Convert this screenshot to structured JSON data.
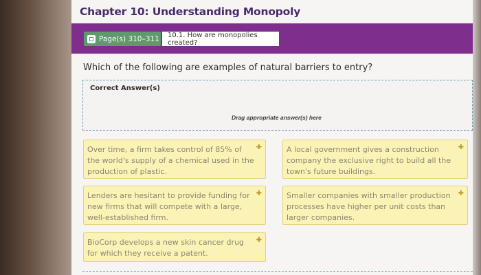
{
  "chapter_title": "Chapter 10: Understanding Monopoly",
  "page_chip": {
    "label": "Page(s) 310–311",
    "icon": "book-icon"
  },
  "section_chip": {
    "label": "10.1. How are monopolies created?"
  },
  "question": "Which of the following are examples of natural barriers to entry?",
  "dropzone": {
    "correct_label": "Correct Answer(s)",
    "hint": "Drag appropriate answer(s) here"
  },
  "answer_cards": [
    {
      "text": "Over time, a firm takes control of 85% of the world's supply of a chemical used in the production of plastic.",
      "icon": "plus"
    },
    {
      "text": "A local government gives a construction company the exclusive right to build all the town's future buildings.",
      "icon": "plus"
    },
    {
      "text": "Lenders are hesitant to provide funding for new firms that will compete with a large, well-established firm.",
      "icon": "plus"
    },
    {
      "text": "Smaller companies with smaller production processes have higher per unit costs than larger companies.",
      "icon": "plus"
    },
    {
      "text": "BioCorp develops a new skin cancer drug for which they receive a patent.",
      "icon": "plus"
    }
  ],
  "colors": {
    "header_bar": "#7e2f8d",
    "page_chip": "#5f9a6c",
    "card_bg": "#fbf3b6",
    "card_border": "#e6d27a",
    "dropzone_border": "#6f9eb0"
  }
}
